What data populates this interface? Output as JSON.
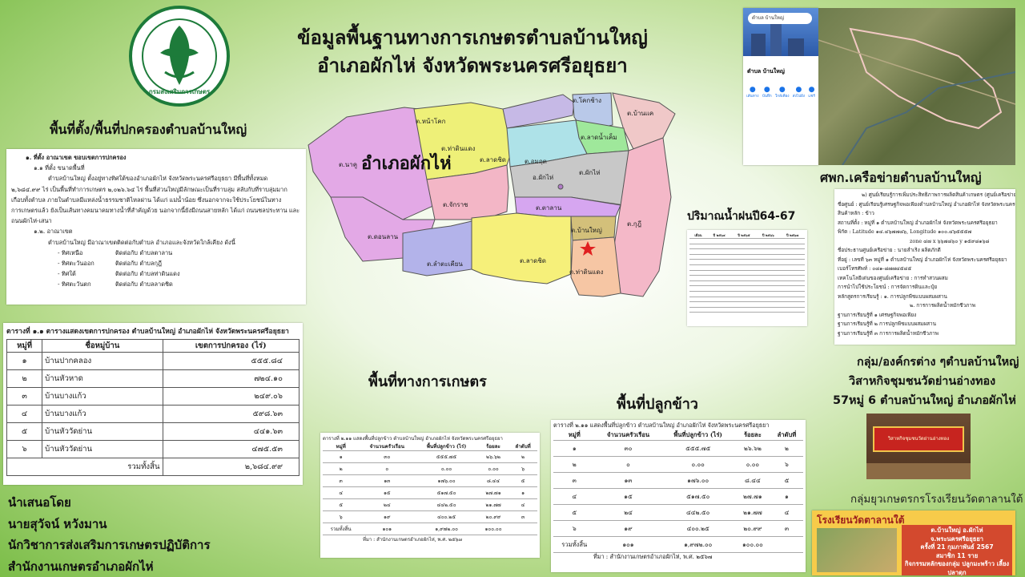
{
  "title": {
    "line1": "ข้อมูลพื้นฐานทางการเกษตรตำบลบ้านใหญ่",
    "line2": "อำเภอผักไห่ จังหวัดพระนครศรีอยุธยา"
  },
  "logo": {
    "caption": "กรมส่งเสริมการเกษตร",
    "color": "#1d7b3a"
  },
  "labels": {
    "location": "พื้นที่ตั้ง/พื้นที่ปกครองตำบลบ้านใหญ่",
    "agri_area": "พื้นที่ทางการเกษตร",
    "rice_area": "พื้นที่ปลูกข้าว",
    "rainfall": "ปริมาณน้ำฝนปี64-67",
    "center": "ศพก.เครือข่ายตำบลบ้านใหญ่",
    "groups_line1": "กลุ่ม/องค์กรต่าง ๆตำบลบ้านใหญ่",
    "groups_line2": "วิสาหกิจชุมชนวัดย่านอ่างทอง",
    "groups_line3": "57หมู่ 6 ตำบลบ้านใหญ่ อำเภอผักไห่",
    "youth_group": "กลุ่มยุวเกษตรกรโรงเรียนวัดตาลานใต้"
  },
  "credits": {
    "line1": "นำเสนอโดย",
    "line2": "นายสุวัจน์ หวังมาน",
    "line3": "นักวิชาการส่งเสริมการเกษตรปฏิบัติการ",
    "line4": "สำนักงานเกษตรอำเภอผักไห่"
  },
  "map": {
    "district_label": "อำเภอผักไห่",
    "marker_color": "#e02020",
    "subdistricts": [
      {
        "name": "ต.นาคู",
        "color": "#e3a9e6"
      },
      {
        "name": "ต.หน้าโคก",
        "color": "#eef078"
      },
      {
        "name": "ต.ท่าดินแดง"
      },
      {
        "name": "ต.โคกช้าง",
        "color": "#b9c9e9"
      },
      {
        "name": "ต.บ้านแค",
        "color": "#f0c8c8"
      },
      {
        "name": "ต.ลาดน้ำเค็ม",
        "color": "#9fe89b"
      },
      {
        "name": "ต.อมฤต",
        "color": "#aee2e8"
      },
      {
        "name": "ต.ผักไห่",
        "color": "#c8c8c8"
      },
      {
        "name": "อ.ผักไห่"
      },
      {
        "name": "ต.ลาดชิด",
        "color": "#f6f07a"
      },
      {
        "name": "ต.จักราช",
        "color": "#f3b6c6"
      },
      {
        "name": "ต.ดอนลาน",
        "color": "#e3a9e6"
      },
      {
        "name": "ต.ตาลาน",
        "color": "#d6a6f0"
      },
      {
        "name": "ต.บ้านใหญ่",
        "color": "#d3c07a"
      },
      {
        "name": "ต.ลำตะเคียน",
        "color": "#b3b3ea"
      },
      {
        "name": "ต.ลาดชิด"
      },
      {
        "name": "ต.ท่าดินแดง",
        "color": "#f6c6a4"
      },
      {
        "name": "ต.กุฎี",
        "color": "#f4b8c8"
      }
    ]
  },
  "location_doc": {
    "heading": "๑. ที่ตั้ง อาณาเขต ขอบเขตการปกครอง",
    "sub1": "๑.๑ ที่ตั้ง ขนาดพื้นที่",
    "para1": "ตำบลบ้านใหญ่ ตั้งอยู่ทางทิศใต้ของอำเภอผักไห่ จังหวัดพระนครศรีอยุธยา มีพื้นที่ทั้งหมด",
    "para2": "๒,๖๘๔.๙๙ ไร่ เป็นพื้นที่ทำการเกษตร ๒,๐๒๖.๖๔ ไร่ พื้นที่ส่วนใหญ่มีลักษณะเป็นที่ราบลุ่ม สลับกับที่ราบลุ่มมาก",
    "para3": "เกือบทั้งตำบล ภายในตำบลมีแหล่งน้ำธรรมชาติไหลผ่าน ได้แก่ แม่น้ำน้อย ซึ่งนอกจากจะใช้ประโยชน์ในทาง",
    "para4": "การเกษตรแล้ว ยังเป็นเส้นทางคมนาคมทางน้ำที่สำคัญด้วย นอกจากนี้ยังมีถนนสายหลัก ได้แก่ ถนนชลประทาน และ",
    "para5": "ถนนผักไห่-เสนา",
    "sub2": "๑.๒. อาณาเขต",
    "para6": "ตำบลบ้านใหญ่ มีอาณาเขตติดต่อกับตำบล อำเภอและจังหวัดใกล้เคียง ดังนี้",
    "bounds": [
      {
        "dir": "- ทิศเหนือ",
        "val": "ติดต่อกับ ตำบลตาลาน"
      },
      {
        "dir": "- ทิศตะวันออก",
        "val": "ติดต่อกับ ตำบลกุฎี"
      },
      {
        "dir": "- ทิศใต้",
        "val": "ติดต่อกับ ตำบลท่าดินแดง"
      },
      {
        "dir": "- ทิศตะวันตก",
        "val": "ติดต่อกับ ตำบลลาดชิด"
      }
    ]
  },
  "admin_table": {
    "caption": "ตารางที่ ๑.๑ ตารางแสดงเขตการปกครอง ตำบลบ้านใหญ่ อำเภอผักไห่ จังหวัดพระนครศรีอยุธยา",
    "headers": [
      "หมู่ที่",
      "ชื่อหมู่บ้าน",
      "เขตการปกครอง (ไร่)"
    ],
    "rows": [
      [
        "๑",
        "บ้านปากคลอง",
        "๕๕๕.๘๔"
      ],
      [
        "๒",
        "บ้านหัวหาด",
        "๗๒๔.๑๐"
      ],
      [
        "๓",
        "บ้านบางแก้ว",
        "๒๔๙.๐๖"
      ],
      [
        "๔",
        "บ้านบางแก้ว",
        "๕๙๘.๖๓"
      ],
      [
        "๕",
        "บ้านหัววัดย่าน",
        "๔๔๑.๖๓"
      ],
      [
        "๖",
        "บ้านหัววัดย่าน",
        "๔๗๕.๕๓"
      ]
    ],
    "total_label": "รวมทั้งสิ้น",
    "total_value": "๒,๖๘๔.๙๙"
  },
  "agri_table": {
    "caption": "ตารางที่ ๒.๑๑ แสดงพื้นที่ปลูกข้าว ตำบลบ้านใหญ่ อำเภอผักไห่ จังหวัดพระนครศรีอยุธยา",
    "headers": [
      "หมู่ที่",
      "จำนวนครัวเรือน",
      "พื้นที่ปลูกข้าว (ไร่)",
      "ร้อยละ",
      "ลำดับที่"
    ],
    "rows": [
      [
        "๑",
        "๓๐",
        "๕๕๕.๗๕",
        "๒๖.๖๒",
        "๒"
      ],
      [
        "๒",
        "๐",
        "๐.๐๐",
        "๐.๐๐",
        "๖"
      ],
      [
        "๓",
        "๑๓",
        "๑๗๖.๐๐",
        "๘.๔๔",
        "๕"
      ],
      [
        "๔",
        "๑๕",
        "๕๑๗.๕๐",
        "๒๗.๗๑",
        "๑"
      ],
      [
        "๕",
        "๒๔",
        "๔๔๒.๕๐",
        "๒๑.๗๗",
        "๔"
      ],
      [
        "๖",
        "๑๙",
        "๔๐๐.๒๕",
        "๒๐.๙๙",
        "๓"
      ]
    ],
    "total_label": "รวมทั้งสิ้น",
    "total_values": [
      "๑๐๑",
      "๑,๙๗๒.๐๐",
      "๑๐๐.๐๐",
      ""
    ],
    "footnote": "ที่มา : สำนักงานเกษตรอำเภอผักไห่, พ.ศ. ๒๕๖๗"
  },
  "rice_table": {
    "caption": "ตารางที่ ๒.๑๑ แสดงพื้นที่ปลูกข้าว ตำบลบ้านใหญ่ อำเภอผักไห่ จังหวัดพระนครศรีอยุธยา",
    "headers": [
      "หมู่ที่",
      "จำนวนครัวเรือน",
      "พื้นที่ปลูกข้าว (ไร่)",
      "ร้อยละ",
      "ลำดับที่"
    ],
    "rows": [
      [
        "๑",
        "๓๐",
        "๕๕๕.๗๕",
        "๒๖.๖๒",
        "๒"
      ],
      [
        "๒",
        "๐",
        "๐.๐๐",
        "๐.๐๐",
        "๖"
      ],
      [
        "๓",
        "๑๓",
        "๑๗๖.๐๐",
        "๘.๔๔",
        "๕"
      ],
      [
        "๔",
        "๑๕",
        "๕๑๗.๕๐",
        "๒๗.๗๑",
        "๑"
      ],
      [
        "๕",
        "๒๔",
        "๔๔๒.๕๐",
        "๒๑.๗๗",
        "๔"
      ],
      [
        "๖",
        "๑๙",
        "๔๐๐.๒๕",
        "๒๐.๙๙",
        "๓"
      ]
    ],
    "total_label": "รวมทั้งสิ้น",
    "total_values": [
      "๑๐๑",
      "๑,๙๗๒.๐๐",
      "๑๐๐.๐๐",
      ""
    ],
    "footnote": "ที่มา : สำนักงานเกษตรอำเภอผักไห่, พ.ศ. ๒๕๖๗"
  },
  "center_doc": {
    "heading": "๒) ศูนย์เรียนรู้การเพิ่มประสิทธิภาพการผลิตสินค้าเกษตร (ศูนย์เครือข่าย)",
    "lines": [
      "ชื่อศูนย์ : ศูนย์เรียนรู้เศรษฐกิจพอเพียงตำบลบ้านใหญ่ อำเภอผักไห่ จังหวัดพระนครศรีอยุธยา",
      "สินค้าหลัก : ข้าว",
      "สถานที่ตั้ง : หมู่ที่ ๑ ตำบลบ้านใหญ่ อำเภอผักไห่ จังหวัดพระนครศรีอยุธยา",
      "พิกัด : Latitude ๑๔.๔๖๗๗๘๖, Longitude ๑๐๐.๔๖๕๕๕๗",
      "zone ๔๗ x ๖๖๗๘๖๐ y ๑๕๙๘๑๖๘",
      "ชื่อประธานศูนย์เครือข่าย : นายสำเริง ผลิตภักดี",
      "ที่อยู่ : เลขที่ ๖๓ หมู่ที่ ๑ ตำบลบ้านใหญ่ อำเภอผักไห่ จังหวัดพระนครศรีอยุธยา",
      "เบอร์โทรศัพท์ : ๐๘๑-๘๗๗๔๕๔๕",
      "เทคโนโลยีเด่นของศูนย์เครือข่าย : การทำสวนผสม",
      "การนำไปใช้ประโยชน์ : การจัดการดินและปุ๋ย",
      "หลักสูตรการเรียนรู้ : ๑. การปลูกพืชแบบผสมผสาน",
      "๒. การการผลิตน้ำหมักชีวภาพ",
      "ฐานการเรียนรู้ที่ ๑ เศรษฐกิจพอเพียง",
      "ฐานการเรียนรู้ที่ ๒ การปลูกพืชแบบผสมผสาน",
      "ฐานการเรียนรู้ที่ ๓ การการผลิตน้ำหมักชีวภาพ"
    ]
  },
  "rain_table": {
    "headers": [
      "เดือน",
      "ปี ๒๕๖๔",
      "ปี ๒๕๖๕",
      "ปี ๒๕๖๖",
      "ปี ๒๕๖๗"
    ]
  },
  "maps_card": {
    "search": "ตำบล บ้านใหญ่",
    "place": "ตำบล บ้านใหญ่",
    "actions": [
      "เส้นทาง",
      "บันทึก",
      "ใกล้เคียง",
      "ส่งไปยัง",
      "แชร์"
    ]
  },
  "banner": {
    "text": "วิสาหกิจชุมชนวัดย่านอ่างทอง"
  },
  "school_poster": {
    "title": "โรงเรียนวัดตาลานใต้",
    "line1": "ต.บ้านใหญ่ อ.ผักไห่",
    "line2": "จ.พระนครศรีอยุธยา",
    "line3": "ครั้งที่ 21 กุมภาพันธ์ 2567",
    "line4": "สมาชิก 11 ราย",
    "line5": "กิจกรรมหลักของกลุ่ม ปลูกมะพร้าว เลี้ยงปลาดุก"
  }
}
